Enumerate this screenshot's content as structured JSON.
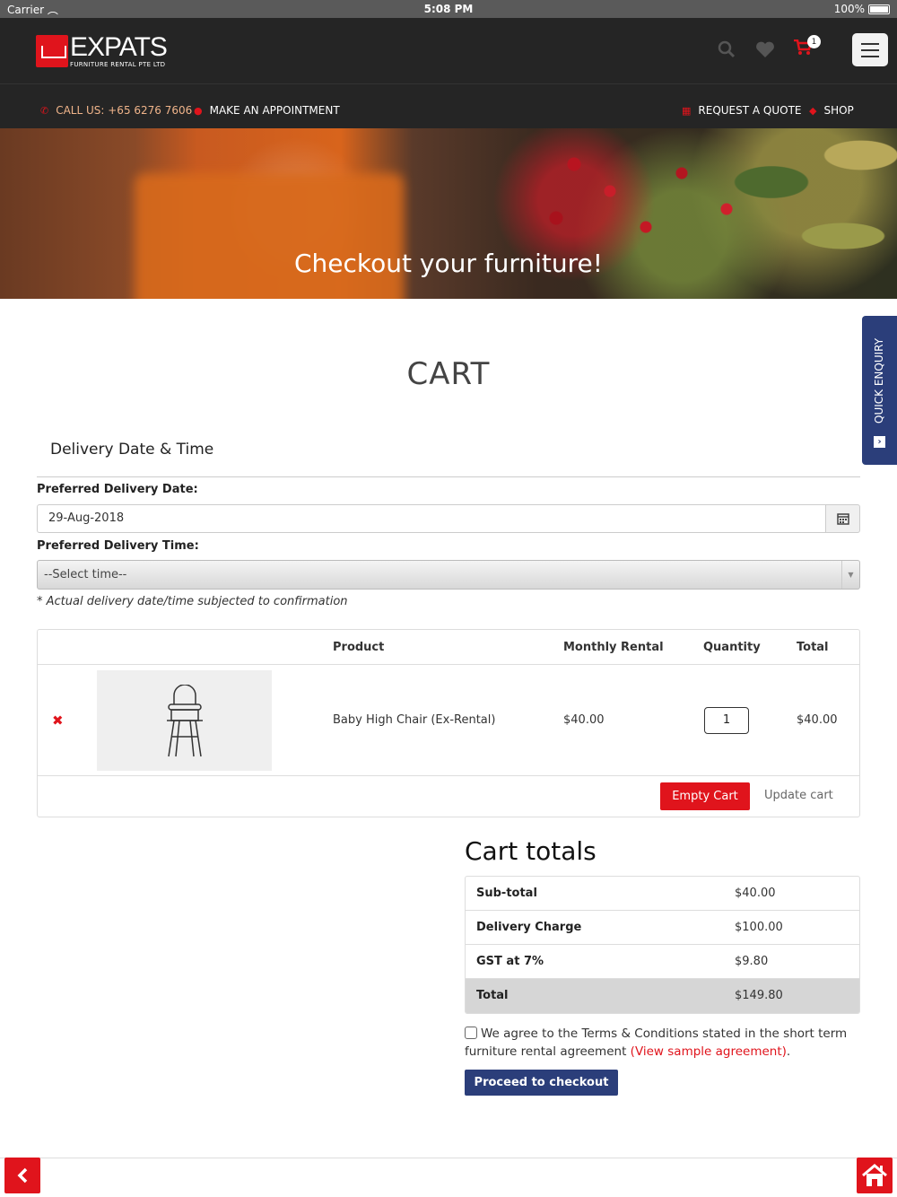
{
  "statusbar": {
    "carrier": "Carrier",
    "time": "5:08 PM",
    "battery": "100%"
  },
  "header": {
    "brand": "EXPATS",
    "brand_sub": "FURNITURE RENTAL PTE LTD",
    "cart_count": "1"
  },
  "subnav": {
    "call": "CALL US: +65 6276 7606",
    "appointment": "MAKE AN APPOINTMENT",
    "quote": "REQUEST A QUOTE",
    "shop": "SHOP"
  },
  "hero": {
    "title": "Checkout your furniture!"
  },
  "quick_enquiry": "QUICK ENQUIRY",
  "page_title": "CART",
  "delivery": {
    "section_title": "Delivery Date & Time",
    "date_label": "Preferred Delivery Date:",
    "date_value": "29-Aug-2018",
    "time_label": "Preferred Delivery Time:",
    "time_value": "--Select time--",
    "note": "* Actual delivery date/time subjected to confirmation"
  },
  "cart_table": {
    "headers": [
      "Product",
      "Monthly Rental",
      "Quantity",
      "Total"
    ],
    "rows": [
      {
        "product": "Baby High Chair (Ex-Rental)",
        "rental": "$40.00",
        "quantity": "1",
        "total": "$40.00"
      }
    ],
    "empty_label": "Empty Cart",
    "update_label": "Update cart"
  },
  "totals": {
    "title": "Cart totals",
    "rows": [
      {
        "label": "Sub-total",
        "value": "$40.00"
      },
      {
        "label": "Delivery Charge",
        "value": "$100.00"
      },
      {
        "label": "GST at 7%",
        "value": "$9.80"
      },
      {
        "label": "Total",
        "value": "$149.80"
      }
    ]
  },
  "agreement": {
    "text": "We agree to the Terms & Conditions stated in the short term furniture rental agreement",
    "link": "(View sample agreement)",
    "end": "."
  },
  "checkout_label": "Proceed to checkout",
  "colors": {
    "brand_red": "#e0141c",
    "brand_blue": "#2b3e7a",
    "header_bg": "#252525"
  }
}
